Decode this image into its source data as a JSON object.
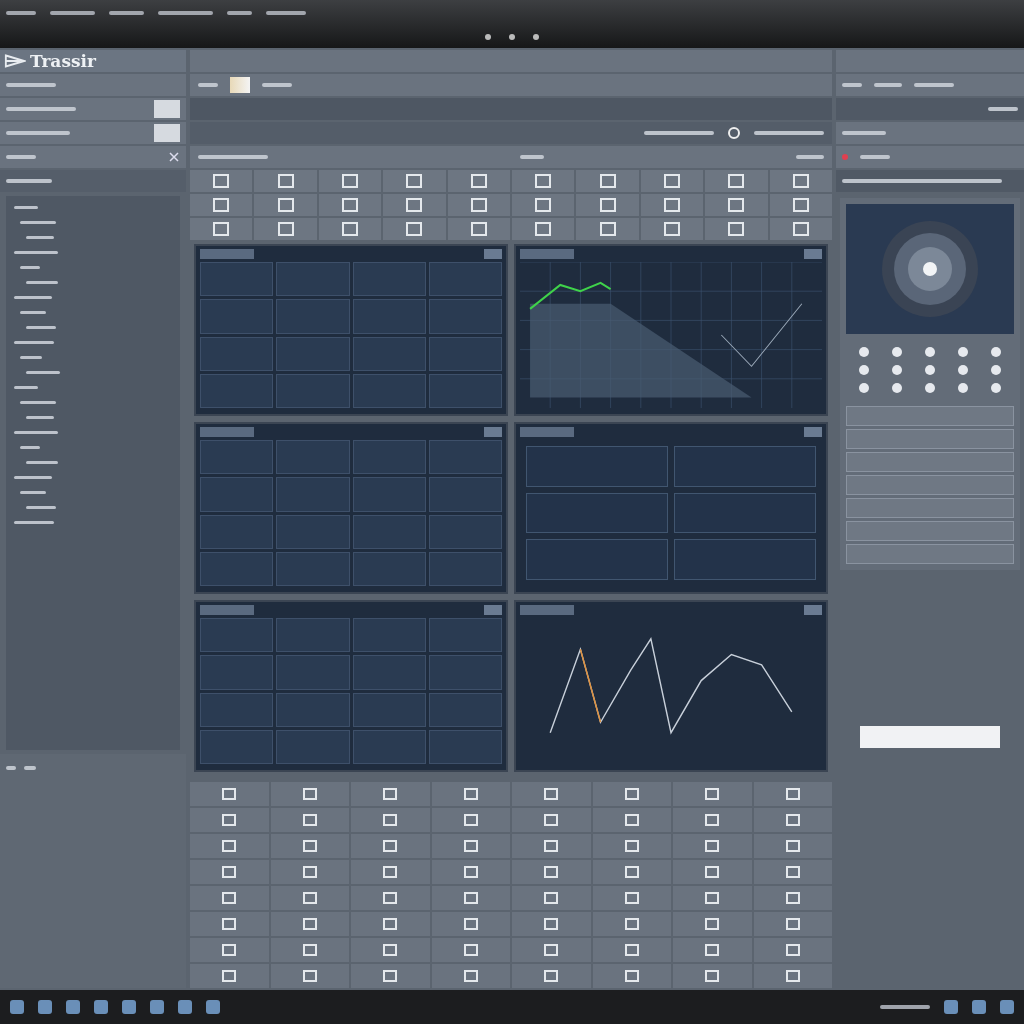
{
  "app": {
    "title": "Trassir"
  },
  "panels": [
    {
      "kind": "grid"
    },
    {
      "kind": "line"
    },
    {
      "kind": "grid"
    },
    {
      "kind": "blocks"
    },
    {
      "kind": "grid"
    },
    {
      "kind": "wave"
    }
  ]
}
